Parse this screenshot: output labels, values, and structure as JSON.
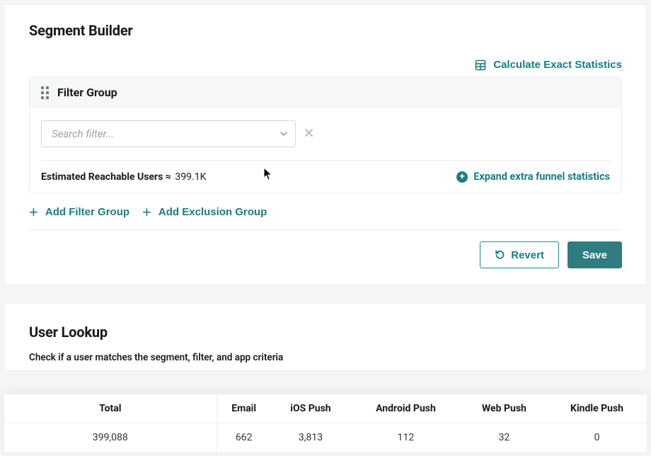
{
  "segment": {
    "title": "Segment Builder",
    "calc_label": "Calculate Exact Statistics",
    "filter_group": {
      "title": "Filter Group",
      "search_placeholder": "Search filter...",
      "estimated_label": "Estimated Reachable Users ≈",
      "estimated_value": "399.1K",
      "expand_label": "Expand extra funnel statistics"
    },
    "add_filter_label": "Add Filter Group",
    "add_exclusion_label": "Add Exclusion Group",
    "revert_label": "Revert",
    "save_label": "Save"
  },
  "lookup": {
    "title": "User Lookup",
    "subtitle": "Check if a user matches the segment, filter, and app criteria"
  },
  "stats": {
    "columns": [
      "Total",
      "Email",
      "iOS Push",
      "Android Push",
      "Web Push",
      "Kindle Push"
    ],
    "values": [
      "399,088",
      "662",
      "3,813",
      "112",
      "32",
      "0"
    ]
  }
}
